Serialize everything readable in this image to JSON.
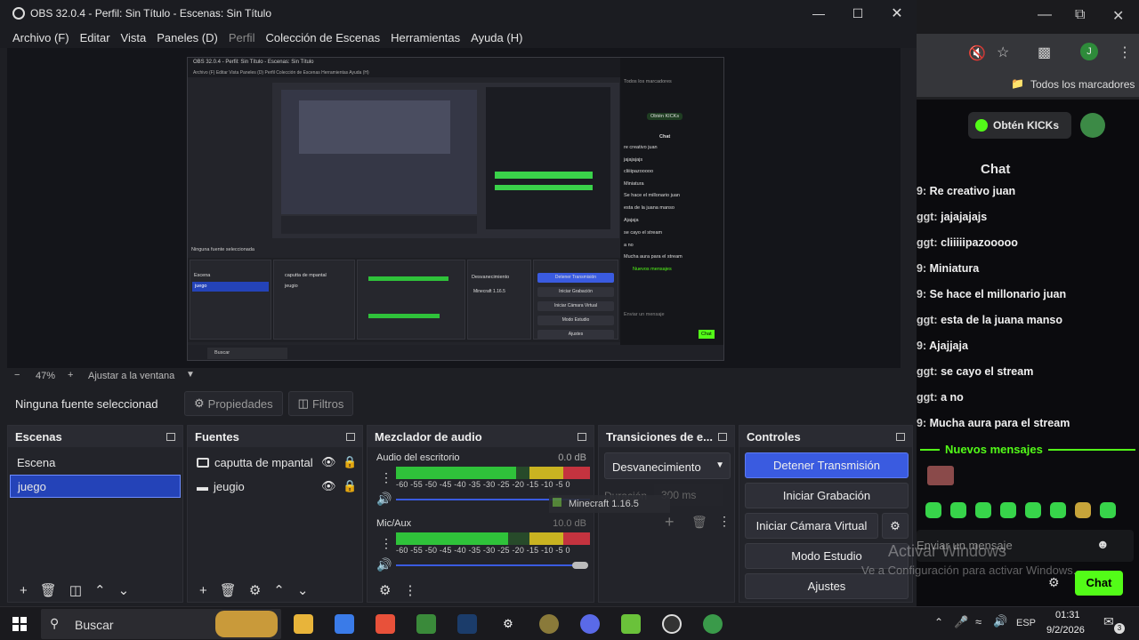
{
  "obs": {
    "window_title": "OBS 32.0.4 - Perfil: Sin Título - Escenas: Sin Título",
    "menu": [
      "Archivo (F)",
      "Editar",
      "Vista",
      "Paneles (D)",
      "Perfil",
      "Colección de Escenas",
      "Herramientas",
      "Ayuda (H)"
    ],
    "zoom": {
      "minus": "−",
      "value": "47%",
      "plus": "+",
      "fit_label": "Ajustar a la ventana"
    },
    "source_bar": {
      "no_source": "Ninguna fuente seleccionad",
      "properties": "Propiedades",
      "filters": "Filtros"
    },
    "scenes": {
      "title": "Escenas",
      "items": [
        "Escena",
        "juego"
      ],
      "selected": "juego"
    },
    "sources": {
      "title": "Fuentes",
      "items": [
        "caputta de mpantal",
        "jeugio"
      ]
    },
    "mixer": {
      "title": "Mezclador de audio",
      "channels": [
        {
          "name": "Audio del escritorio",
          "db": "0.0 dB",
          "level": 0.62
        },
        {
          "name": "Mic/Aux",
          "db": "10.0 dB",
          "level": 0.58
        }
      ],
      "scale": "-60 -55 -50 -45 -40 -35 -30 -25 -20 -15 -10 -5 0"
    },
    "transitions": {
      "title": "Transiciones de e...",
      "selected": "Desvanecimiento",
      "duration_label": "Duración",
      "duration_value": "300 ms",
      "overlay_source": "Minecraft 1.16.5"
    },
    "controls": {
      "title": "Controles",
      "buttons": [
        "Detener Transmisión",
        "Iniciar Grabación",
        "Iniciar Cámara Virtual",
        "Modo Estudio",
        "Ajustes"
      ]
    },
    "nested_preview": {
      "title": "OBS 32.0.4 - Perfil: Sin Título - Escenas: Sin Título",
      "menu": "Archivo (F)   Editar   Vista   Paneles (D)   Perfil   Colección de Escenas   Herramientas   Ayuda (H)",
      "no_source": "Ninguna fuente seleccionada",
      "chat_lines": [
        "re creativo juan",
        "jajajajajs",
        "cliiiipazooooo",
        "Miniatura",
        "Se hace el millonario juan",
        "esta de la juana manso",
        "Ajajaja",
        "se cayo el stream",
        "a no",
        "Mucha aura para el stream"
      ],
      "new_messages": "Nuevos mensajes",
      "kicks": "Obtén KICKs",
      "chat_title": "Chat",
      "send_placeholder": "Enviar un mensaje",
      "chat_button": "Chat",
      "bookmarks": "Todos los marcadores",
      "ctrl_buttons": [
        "Detener Transmisión",
        "Iniciar Grabación",
        "Iniciar Cámara Virtual",
        "Modo Estudio",
        "Ajustes"
      ],
      "scenes": [
        "Escena",
        "juego"
      ],
      "sources": [
        "caputta de mpantal",
        "jeugio"
      ],
      "transition": "Desvanecimiento",
      "overlay": "Minecraft 1.16.5",
      "search": "Buscar"
    }
  },
  "browser": {
    "bookmarks": "Todos los marcadores",
    "profile_initial": "J",
    "kicks_button": "Obtén KICKs",
    "chat_title": "Chat",
    "messages": [
      {
        "user": "9:",
        "text": "Re creativo juan"
      },
      {
        "user": "ggt:",
        "text": "jajajajajs"
      },
      {
        "user": "ggt:",
        "text": "cliiiiipazooooo"
      },
      {
        "user": "9:",
        "text": "Miniatura"
      },
      {
        "user": "9:",
        "text": "Se hace el millonario juan"
      },
      {
        "user": "ggt:",
        "text": "esta de la juana manso"
      },
      {
        "user": "9:",
        "text": "Ajajjaja"
      },
      {
        "user": "ggt:",
        "text": "se cayo el stream"
      },
      {
        "user": "ggt:",
        "text": "a no"
      },
      {
        "user": "9:",
        "text": "Mucha aura para el stream"
      }
    ],
    "new_messages": "Nuevos mensajes",
    "input_placeholder": "Enviar un mensaje",
    "chat_button": "Chat"
  },
  "watermark": {
    "line1": "Activar Windows",
    "line2": "Ve a Configuración para activar Windows."
  },
  "taskbar": {
    "search": "Buscar",
    "lang": "ESP",
    "time": "01:31",
    "date": "9/2/2026",
    "notif_count": "3"
  },
  "colors": {
    "accent": "#3a5be0",
    "kick_green": "#53fc18",
    "meter_green": "#2fc23a"
  }
}
